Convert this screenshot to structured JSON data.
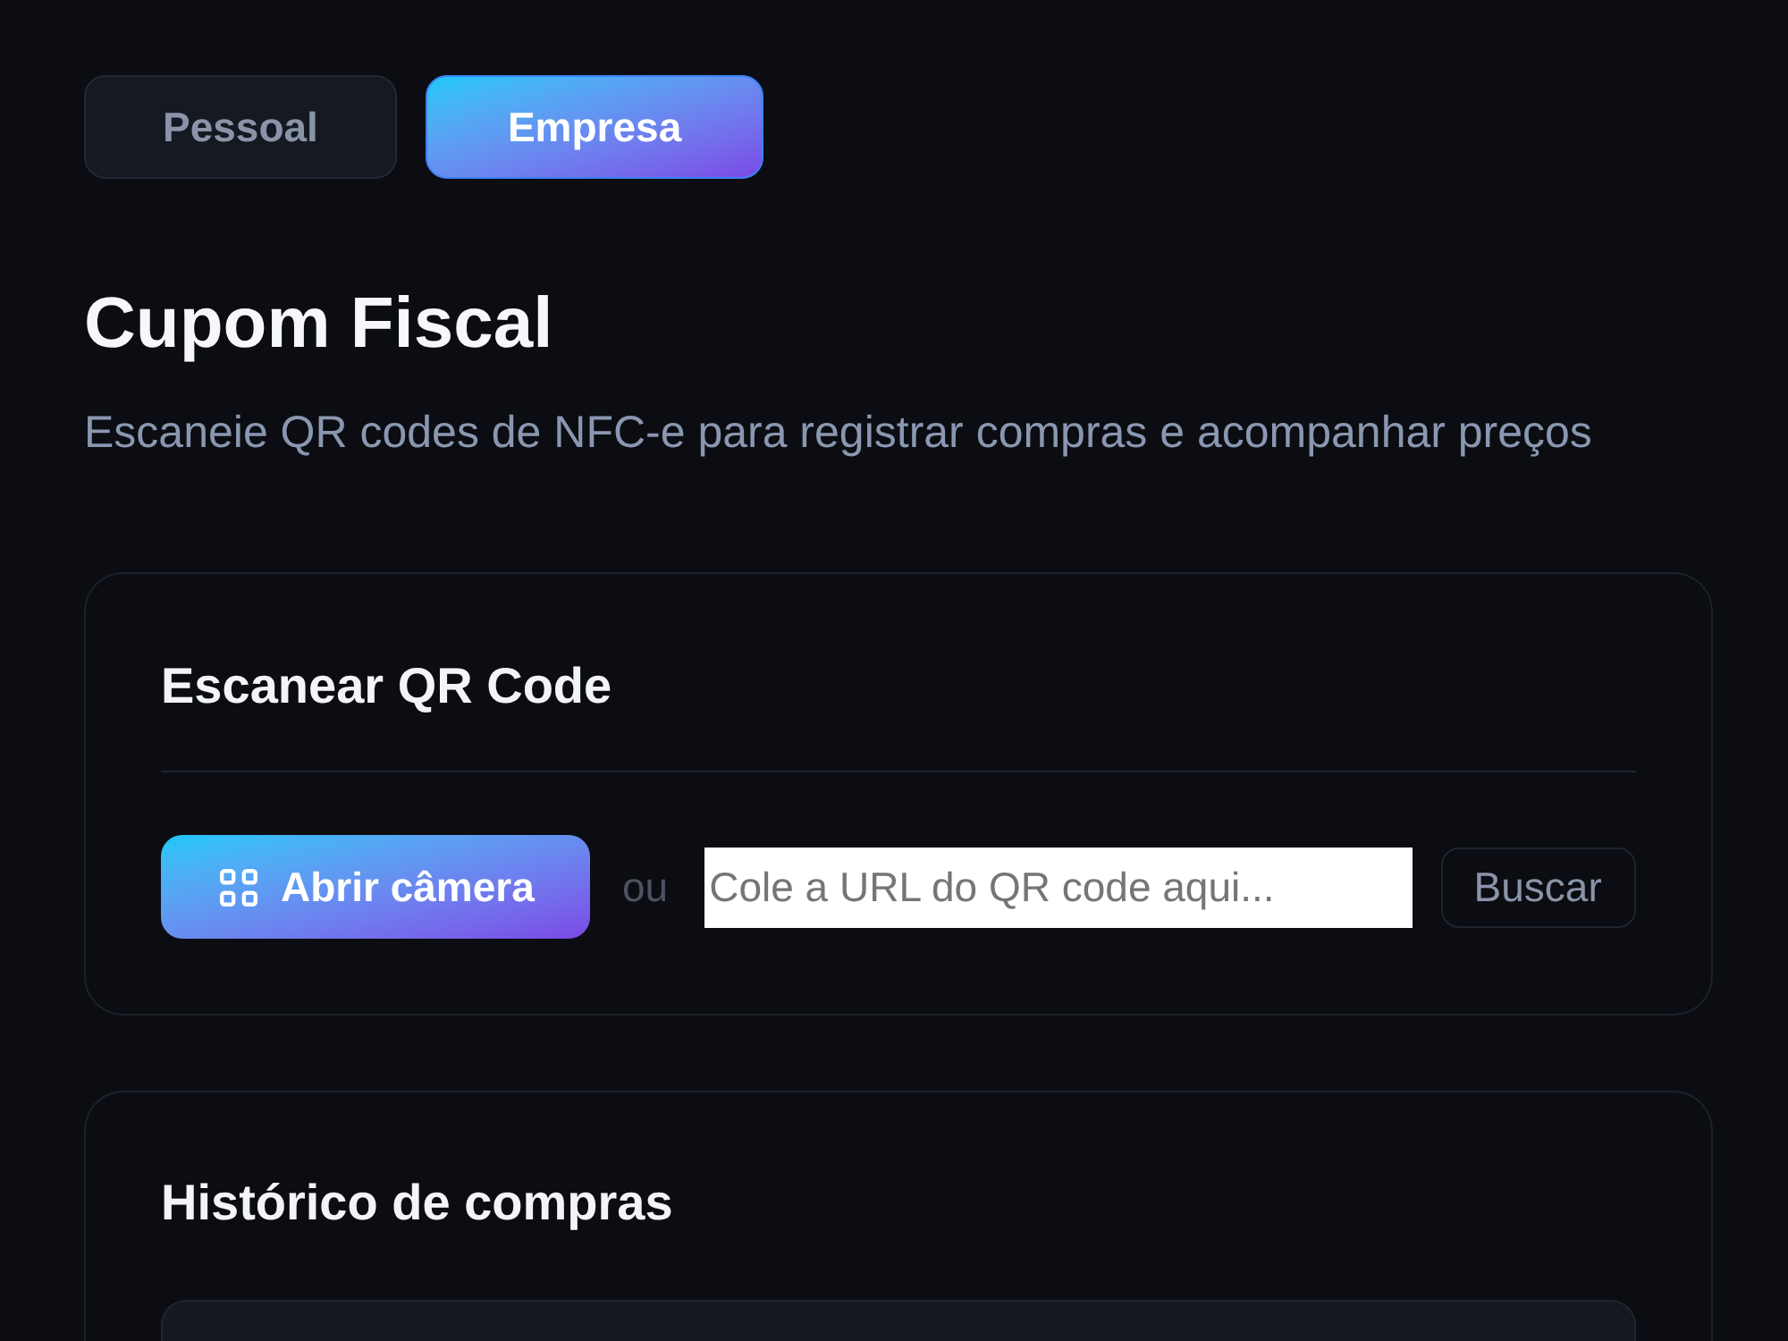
{
  "tabs": [
    {
      "label": "Pessoal",
      "selected": false
    },
    {
      "label": "Empresa",
      "selected": true
    }
  ],
  "header": {
    "title": "Cupom Fiscal",
    "subtitle": "Escaneie QR codes de NFC-e para registrar compras e acompanhar preços"
  },
  "scan_card": {
    "title": "Escanear QR Code",
    "camera_button": "Abrir câmera",
    "separator": "ou",
    "url_field": {
      "placeholder": "Cole a URL do QR code aqui..."
    },
    "search_button": "Buscar"
  },
  "history_card": {
    "title": "Histórico de compras"
  }
}
